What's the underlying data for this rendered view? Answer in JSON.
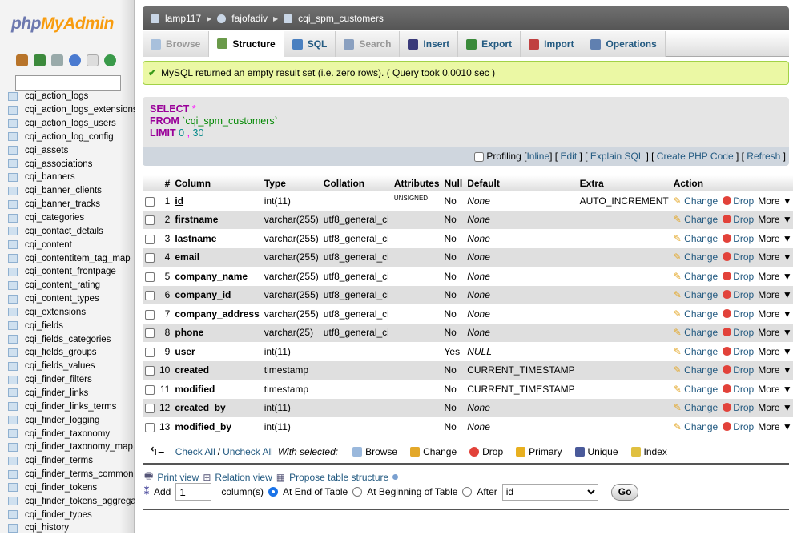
{
  "logo": {
    "php": "php",
    "mya": "MyAdmin"
  },
  "sidebar": {
    "filter_value": "",
    "tables": [
      "cqi_action_logs",
      "cqi_action_logs_extensions",
      "cqi_action_logs_users",
      "cqi_action_log_config",
      "cqi_assets",
      "cqi_associations",
      "cqi_banners",
      "cqi_banner_clients",
      "cqi_banner_tracks",
      "cqi_categories",
      "cqi_contact_details",
      "cqi_content",
      "cqi_contentitem_tag_map",
      "cqi_content_frontpage",
      "cqi_content_rating",
      "cqi_content_types",
      "cqi_extensions",
      "cqi_fields",
      "cqi_fields_categories",
      "cqi_fields_groups",
      "cqi_fields_values",
      "cqi_finder_filters",
      "cqi_finder_links",
      "cqi_finder_links_terms",
      "cqi_finder_logging",
      "cqi_finder_taxonomy",
      "cqi_finder_taxonomy_map",
      "cqi_finder_terms",
      "cqi_finder_terms_common",
      "cqi_finder_tokens",
      "cqi_finder_tokens_aggregate",
      "cqi_finder_types",
      "cqi_history"
    ]
  },
  "breadcrumb": {
    "server": "lamp117",
    "database": "fajofadiv",
    "table": "cqi_spm_customers"
  },
  "tabs": [
    {
      "label": "Browse",
      "state": "disabled"
    },
    {
      "label": "Structure",
      "state": "active"
    },
    {
      "label": "SQL"
    },
    {
      "label": "Search",
      "state": "disabled"
    },
    {
      "label": "Insert"
    },
    {
      "label": "Export"
    },
    {
      "label": "Import"
    },
    {
      "label": "Operations"
    }
  ],
  "message": "MySQL returned an empty result set (i.e. zero rows). ( Query took 0.0010 sec )",
  "sql": {
    "select": "SELECT",
    "star": "*",
    "from": "FROM",
    "table": "`cqi_spm_customers`",
    "limit": "LIMIT",
    "l0": "0",
    "comma": ",",
    "l1": "30"
  },
  "sqlbar": {
    "profiling": "Profiling",
    "inline": "Inline",
    "edit": "Edit",
    "explain": "Explain SQL",
    "php": "Create PHP Code",
    "refresh": "Refresh"
  },
  "table": {
    "headers": [
      "#",
      "Column",
      "Type",
      "Collation",
      "Attributes",
      "Null",
      "Default",
      "Extra",
      "Action"
    ],
    "rows": [
      [
        "1",
        "id",
        "int(11)",
        "",
        "UNSIGNED",
        "No",
        "None",
        "AUTO_INCREMENT"
      ],
      [
        "2",
        "firstname",
        "varchar(255)",
        "utf8_general_ci",
        "",
        "No",
        "None",
        ""
      ],
      [
        "3",
        "lastname",
        "varchar(255)",
        "utf8_general_ci",
        "",
        "No",
        "None",
        ""
      ],
      [
        "4",
        "email",
        "varchar(255)",
        "utf8_general_ci",
        "",
        "No",
        "None",
        ""
      ],
      [
        "5",
        "company_name",
        "varchar(255)",
        "utf8_general_ci",
        "",
        "No",
        "None",
        ""
      ],
      [
        "6",
        "company_id",
        "varchar(255)",
        "utf8_general_ci",
        "",
        "No",
        "None",
        ""
      ],
      [
        "7",
        "company_address",
        "varchar(255)",
        "utf8_general_ci",
        "",
        "No",
        "None",
        ""
      ],
      [
        "8",
        "phone",
        "varchar(25)",
        "utf8_general_ci",
        "",
        "No",
        "None",
        ""
      ],
      [
        "9",
        "user",
        "int(11)",
        "",
        "",
        "Yes",
        "NULL",
        ""
      ],
      [
        "10",
        "created",
        "timestamp",
        "",
        "",
        "No",
        "CURRENT_TIMESTAMP",
        ""
      ],
      [
        "11",
        "modified",
        "timestamp",
        "",
        "",
        "No",
        "CURRENT_TIMESTAMP",
        ""
      ],
      [
        "12",
        "created_by",
        "int(11)",
        "",
        "",
        "No",
        "None",
        ""
      ],
      [
        "13",
        "modified_by",
        "int(11)",
        "",
        "",
        "No",
        "None",
        ""
      ]
    ],
    "actions": {
      "change": "Change",
      "drop": "Drop",
      "more": "More ▼"
    }
  },
  "with_selected": {
    "check_all": "Check All",
    "slash": "/",
    "uncheck_all": "Uncheck All",
    "label": "With selected:",
    "ops": [
      "Browse",
      "Change",
      "Drop",
      "Primary",
      "Unique",
      "Index"
    ]
  },
  "links": {
    "print": "Print view",
    "relation": "Relation view",
    "propose": "Propose table structure"
  },
  "add": {
    "label": "Add",
    "count": "1",
    "columns": "column(s)",
    "end": "At End of Table",
    "begin": "At Beginning of Table",
    "after": "After",
    "after_value": "id",
    "go": "Go"
  }
}
